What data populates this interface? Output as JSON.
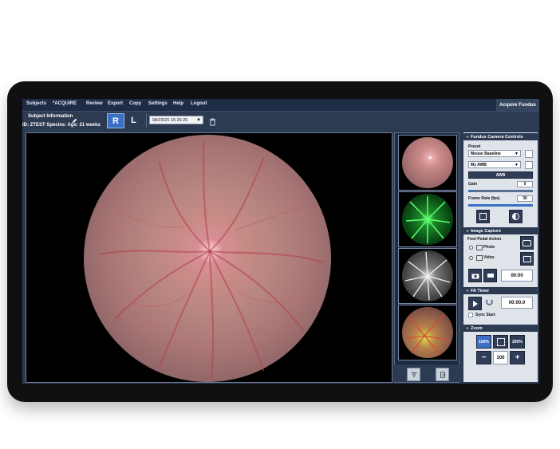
{
  "menu": {
    "items": [
      "Subjects",
      "*ACQUIRE",
      "Review",
      "Export",
      "Copy",
      "Settings",
      "Help",
      "Logout"
    ],
    "mode_label": "Acquire Fundus"
  },
  "subject": {
    "title": "Subject Information",
    "id_line": "ID: ZTEST Species:   Age: 21 weeks",
    "eye_right": "R",
    "eye_left": "L",
    "session_date": "08/29/25 15:26:25"
  },
  "camera": {
    "section_title": "Fundus Camera Controls",
    "preset_label": "Preset",
    "preset_value": "Mouse Baseline",
    "wb_value": "My AWB",
    "awb_button": "AWB",
    "gain_label": "Gain",
    "gain_value": "0",
    "framerate_label": "Frame Rate (fps)",
    "framerate_value": "30",
    "gain_fraction": 0.05,
    "framerate_fraction": 0.98
  },
  "capture": {
    "section_title": "Image Capture",
    "pedal_label": "Foot Pedal Action",
    "photo_label": "Photo",
    "video_label": "Video",
    "time_value": "00:00"
  },
  "fa": {
    "section_title": "FA Timer",
    "time_value": "00:00.0",
    "sync_label": "Sync Start"
  },
  "zoom": {
    "section_title": "Zoom",
    "preset_100": "100%",
    "preset_200": "200%",
    "minus": "−",
    "plus": "+",
    "value": "100"
  },
  "icons": {
    "edit": "pencil-icon",
    "trash": "trash-icon",
    "filter": "filter-icon",
    "export": "export-icon",
    "camera": "camera-icon",
    "video": "video-icon",
    "play": "play-icon",
    "reset": "refresh-icon",
    "fit": "fit-screen-icon"
  },
  "colors": {
    "menu_bg": "#1f2c45",
    "panel_bg": "#dfe4ea",
    "accent_blue": "#3b6fc5",
    "fluorescein_green": "#2fd04a"
  }
}
